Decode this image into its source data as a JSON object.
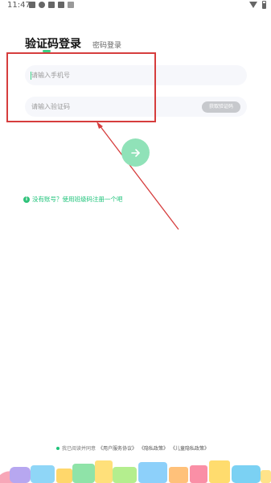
{
  "status_bar": {
    "time": "11:47",
    "left_icons": [
      "image-icon",
      "notification-icon",
      "app-icon",
      "a-icon",
      "cast-icon"
    ],
    "right_icons": [
      "wifi-icon",
      "battery-icon"
    ]
  },
  "tabs": {
    "code_login": "验证码登录",
    "password_login": "密码登录"
  },
  "form": {
    "phone_placeholder": "请输入手机号",
    "code_placeholder": "请输入验证码",
    "get_code_label": "获取验证码"
  },
  "register": {
    "link_text": "没有账号？使用班级码注册一个吧"
  },
  "agreement": {
    "prefix": "我已阅读并同意",
    "user_agreement": "《用户服务协议》",
    "privacy_policy": "《隐私政策》",
    "child_privacy_policy": "《儿童隐私政策》"
  },
  "colors": {
    "accent": "#1ec37a",
    "button_light": "#90e2b8",
    "annotation_red": "#d63d3d"
  }
}
